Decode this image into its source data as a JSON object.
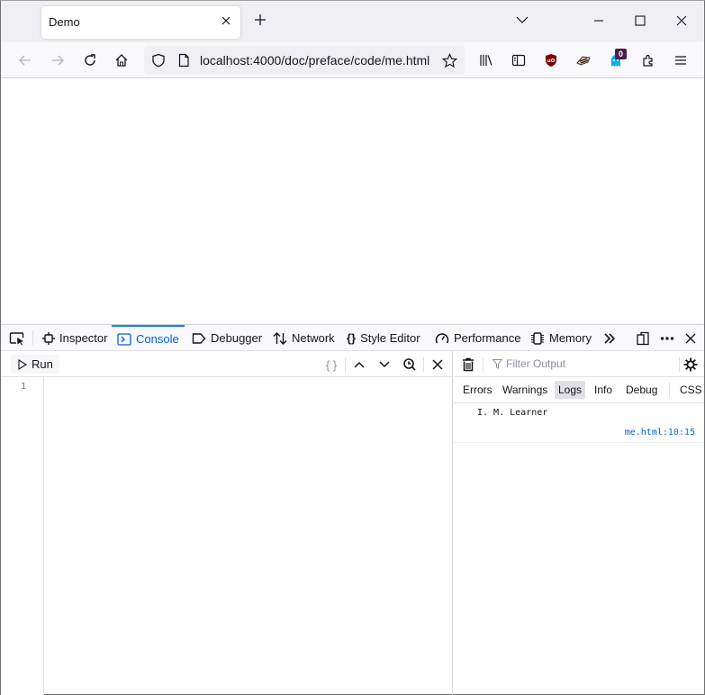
{
  "browser": {
    "tab": {
      "title": "Demo",
      "close_icon": "close-icon"
    },
    "new_tab_icon": "plus-icon",
    "url": "localhost:4000/doc/preface/code/me.html",
    "extension_badge_count": "0"
  },
  "devtools": {
    "tabs": [
      {
        "label": "Inspector",
        "icon": "inspector-icon"
      },
      {
        "label": "Console",
        "icon": "console-icon",
        "active": true
      },
      {
        "label": "Debugger",
        "icon": "debugger-icon"
      },
      {
        "label": "Network",
        "icon": "network-icon"
      },
      {
        "label": "Style Editor",
        "icon": "style-editor-icon"
      },
      {
        "label": "Performance",
        "icon": "performance-icon"
      },
      {
        "label": "Memory",
        "icon": "memory-icon"
      }
    ],
    "editor": {
      "run_label": "Run",
      "pretty_print_label": "{ }",
      "line_numbers": [
        "1"
      ]
    },
    "output": {
      "filter_placeholder": "Filter Output",
      "filters": [
        {
          "label": "Errors"
        },
        {
          "label": "Warnings"
        },
        {
          "label": "Logs",
          "active": true
        },
        {
          "label": "Info"
        },
        {
          "label": "Debug"
        },
        {
          "label": "CSS"
        }
      ],
      "logs": [
        {
          "message": "I. M. Learner",
          "source_file": "me.html",
          "source_line": ":10:15"
        }
      ]
    }
  }
}
